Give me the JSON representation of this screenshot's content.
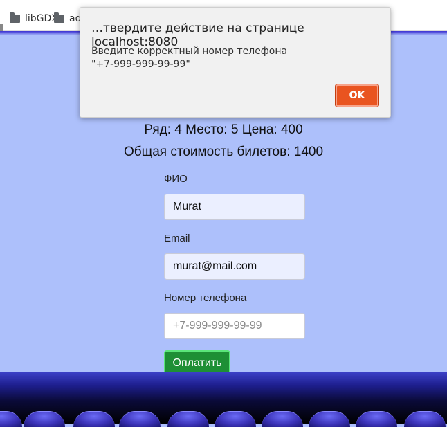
{
  "bookmarks": [
    {
      "label": "libGDX"
    },
    {
      "label": "ad"
    }
  ],
  "dialog": {
    "title": "…твердите действие на странице localhost:8080",
    "message": "Введите корректный номер телефона\n\"+7-999-999-99-99\"",
    "ok_label": "OK"
  },
  "booking": {
    "seat_line": "Ряд: 4 Место: 5 Цена: 400",
    "total_line": "Общая стоимость билетов: 1400"
  },
  "form": {
    "fio_label": "ФИО",
    "fio_value": "Murat",
    "email_label": "Email",
    "email_value": "murat@mail.com",
    "phone_label": "Номер телефона",
    "phone_placeholder": "+7-999-999-99-99",
    "pay_label": "Оплатить"
  },
  "colors": {
    "page_bg": "#adc0fb",
    "pay_button": "#1e8f35",
    "ok_button": "#e95420"
  }
}
